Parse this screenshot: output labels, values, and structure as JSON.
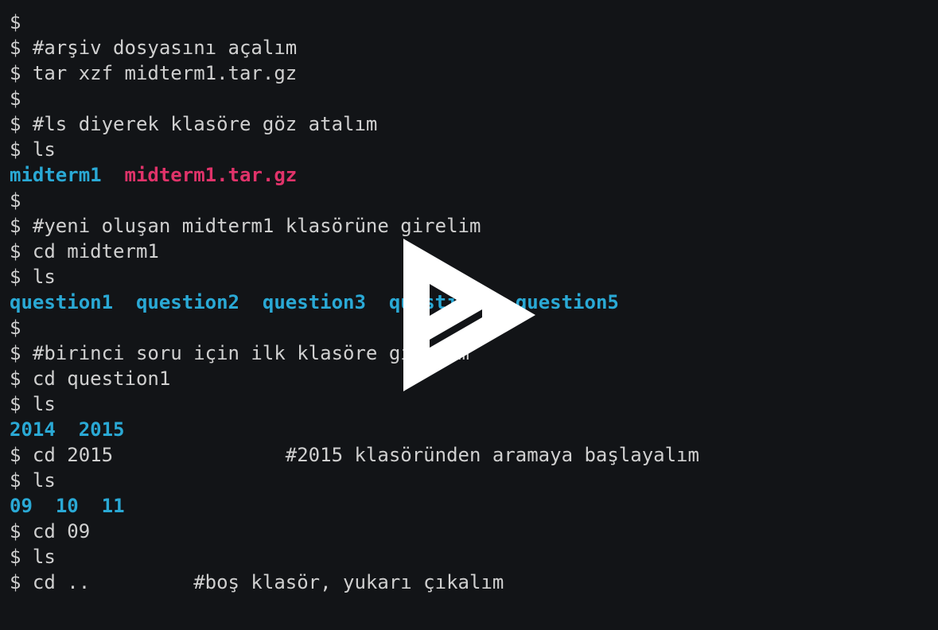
{
  "terminal": {
    "lines": [
      {
        "type": "cmd",
        "text": "$"
      },
      {
        "type": "cmd",
        "text": "$ #arşiv dosyasını açalım"
      },
      {
        "type": "cmd",
        "text": "$ tar xzf midterm1.tar.gz"
      },
      {
        "type": "cmd",
        "text": "$"
      },
      {
        "type": "cmd",
        "text": "$ #ls diyerek klasöre göz atalım"
      },
      {
        "type": "cmd",
        "text": "$ ls"
      },
      {
        "type": "ls",
        "items": [
          {
            "name": "midterm1",
            "kind": "dir"
          },
          {
            "name": "midterm1.tar.gz",
            "kind": "archive"
          }
        ]
      },
      {
        "type": "cmd",
        "text": "$"
      },
      {
        "type": "cmd",
        "text": "$ #yeni oluşan midterm1 klasörüne girelim"
      },
      {
        "type": "cmd",
        "text": "$ cd midterm1"
      },
      {
        "type": "cmd",
        "text": "$ ls"
      },
      {
        "type": "ls",
        "items": [
          {
            "name": "question1",
            "kind": "dir"
          },
          {
            "name": "question2",
            "kind": "dir"
          },
          {
            "name": "question3",
            "kind": "dir"
          },
          {
            "name": "question4",
            "kind": "dir"
          },
          {
            "name": "question5",
            "kind": "dir"
          }
        ]
      },
      {
        "type": "cmd",
        "text": "$"
      },
      {
        "type": "cmd",
        "text": "$ #birinci soru için ilk klasöre girelim"
      },
      {
        "type": "cmd",
        "text": "$ cd question1"
      },
      {
        "type": "cmd",
        "text": "$ ls"
      },
      {
        "type": "ls",
        "items": [
          {
            "name": "2014",
            "kind": "dir"
          },
          {
            "name": "2015",
            "kind": "dir"
          }
        ]
      },
      {
        "type": "cmd",
        "text": "$ cd 2015               #2015 klasöründen aramaya başlayalım"
      },
      {
        "type": "cmd",
        "text": "$ ls"
      },
      {
        "type": "ls",
        "items": [
          {
            "name": "09",
            "kind": "dir"
          },
          {
            "name": "10",
            "kind": "dir"
          },
          {
            "name": "11",
            "kind": "dir"
          }
        ]
      },
      {
        "type": "cmd",
        "text": "$ cd 09"
      },
      {
        "type": "cmd",
        "text": "$ ls"
      },
      {
        "type": "cmd",
        "text": "$ cd ..         #boş klasör, yukarı çıkalım"
      }
    ]
  },
  "overlay": {
    "icon": "asciinema-play-icon"
  },
  "colors": {
    "background": "#121417",
    "text": "#d0d0d0",
    "directory": "#2aa9d5",
    "archive": "#e0336a",
    "overlay": "#ffffff"
  }
}
